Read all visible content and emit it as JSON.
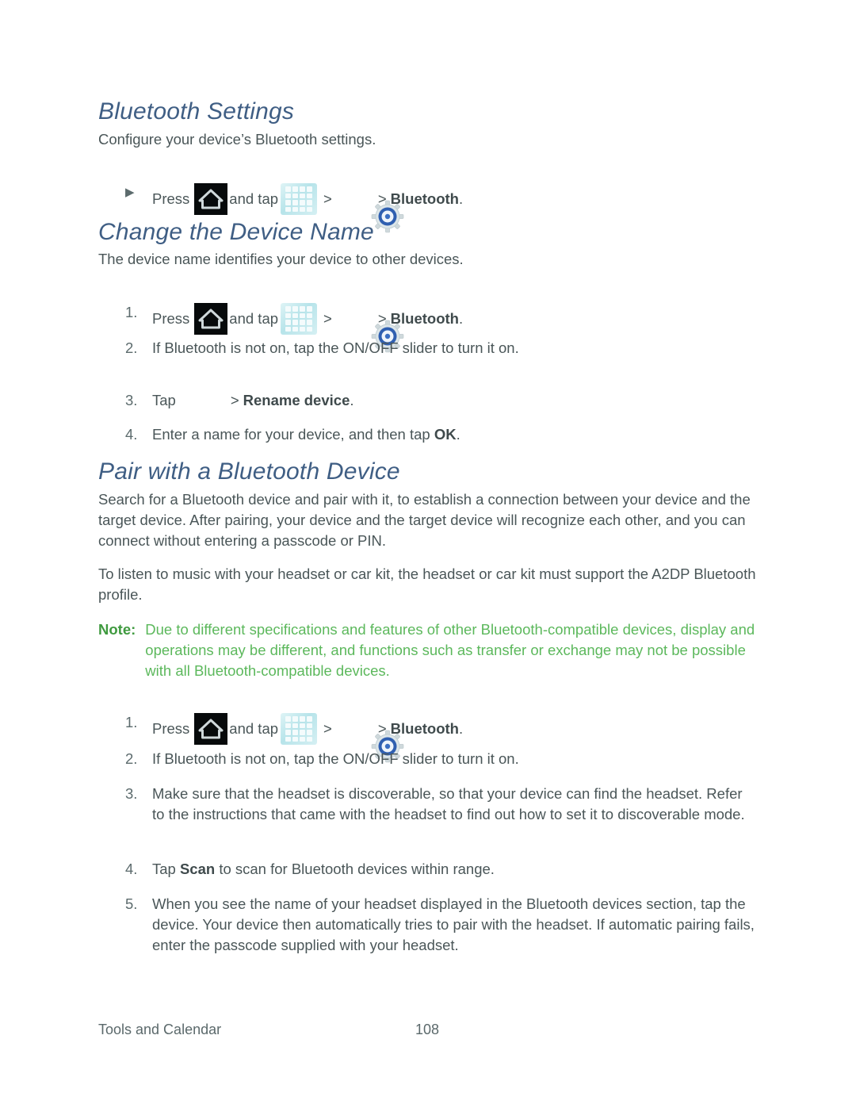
{
  "document": {
    "sections": [
      {
        "heading": "Bluetooth Settings",
        "intro": "Configure your device’s Bluetooth settings.",
        "bullet_step": {
          "marker": "▶",
          "press": "Press",
          "and_tap": "and tap",
          "sep1": ">",
          "sep2": ">",
          "target": "Bluetooth",
          "period": "."
        }
      },
      {
        "heading": "Change the Device Name",
        "intro": "The device name identifies your device to other devices.",
        "steps": [
          {
            "marker": "1.",
            "press": "Press",
            "and_tap": "and tap",
            "sep1": ">",
            "sep2": ">",
            "target": "Bluetooth",
            "period": "."
          },
          {
            "marker": "2.",
            "text": "If Bluetooth is not on, tap the ON/OFF slider to turn it on."
          },
          {
            "marker": "3.",
            "tap": "Tap",
            "sep": ">",
            "target": "Rename device",
            "period": "."
          },
          {
            "marker": "4.",
            "text_pre": "Enter a name for your device, and then tap ",
            "bold": "OK",
            "text_post": "."
          }
        ]
      },
      {
        "heading": "Pair with a Bluetooth Device",
        "paragraphs": [
          "Search for a Bluetooth device and pair with it, to establish a connection between your device and the target device. After pairing, your device and the target device will recognize each other, and you can connect without entering a passcode or PIN.",
          "To listen to music with your headset or car kit, the headset or car kit must support the A2DP Bluetooth profile."
        ],
        "note": {
          "label": "Note:",
          "body": "Due to different specifications and features of other Bluetooth-compatible devices, display and operations may be different, and functions such as transfer or exchange may not be possible with all Bluetooth-compatible devices."
        },
        "steps": [
          {
            "marker": "1.",
            "press": "Press",
            "and_tap": "and tap",
            "sep1": ">",
            "sep2": ">",
            "target": "Bluetooth",
            "period": "."
          },
          {
            "marker": "2.",
            "text": "If Bluetooth is not on, tap the ON/OFF slider to turn it on."
          },
          {
            "marker": "3.",
            "text": "Make sure that the headset is discoverable, so that your device can find the headset. Refer to the instructions that came with the headset to find out how to set it to discoverable mode."
          },
          {
            "marker": "4.",
            "text_pre": "Tap ",
            "bold": "Scan",
            "text_post": " to scan for Bluetooth devices within range."
          },
          {
            "marker": "5.",
            "text": "When you see the name of your headset displayed in the Bluetooth devices section, tap the device. Your device then automatically tries to pair with the headset. If automatic pairing fails, enter the passcode supplied with your headset."
          }
        ]
      }
    ],
    "icons": {
      "home": "home-icon",
      "apps": "apps-grid-icon",
      "settings": "settings-gear-icon",
      "missing": "missing-menu-icon"
    },
    "footer": {
      "chapter": "Tools and Calendar",
      "page_number": "108"
    },
    "colors": {
      "heading": "#3f5e84",
      "body": "#4a5658",
      "note_label": "#3f9a3f",
      "note_body": "#5cb85c",
      "page_background": "#ffffff"
    }
  }
}
